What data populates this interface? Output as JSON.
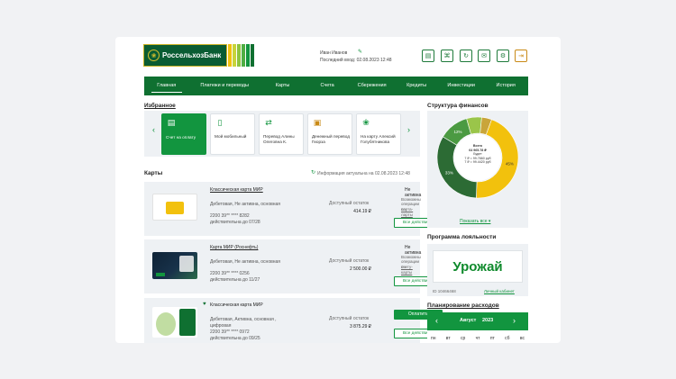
{
  "brand": {
    "name": "РоссельхозБанк",
    "colors": {
      "primary": "#0f7031",
      "accent": "#12953f",
      "gold": "#f2c10d"
    }
  },
  "user": {
    "name": "Иван Иванов",
    "last_login": "Последний вход: 02.08.2023 12:48"
  },
  "toolbar": {
    "icons": [
      "document-icon",
      "receipt-icon",
      "refresh-icon",
      "mail-icon",
      "gear-icon",
      "exit-icon"
    ]
  },
  "nav": {
    "items": [
      "Главная",
      "Платежи и переводы",
      "Карты",
      "Счета",
      "Сбережения",
      "Кредиты",
      "Инвестиции",
      "История"
    ],
    "active": 0
  },
  "favorites": {
    "title": "Избранное",
    "items": [
      {
        "label": "Счет на оплату",
        "icon": "invoice-icon"
      },
      {
        "label": "Мой мобильный",
        "icon": "phone-icon"
      },
      {
        "label": "Перевод Алины Олеговна К.",
        "icon": "transfer-icon"
      },
      {
        "label": "Денежный перевод Гиорза",
        "icon": "money-icon"
      },
      {
        "label": "На карту Алексий Голубятникова",
        "icon": "card-transfer-icon"
      }
    ]
  },
  "cards": {
    "title": "Карты",
    "info": "Информация актуальна на 02.08.2023 12:48",
    "items": [
      {
        "name": "Классическая карта МИР",
        "type": "Дебетовая, Не активна, основная",
        "number": "2200 39** **** 8282",
        "valid": "действительна до 07/28",
        "balance_label": "Доступный остаток",
        "balance": "414.19 ₽",
        "status": "Не активна",
        "note1": "Возможны",
        "note2": "операции по",
        "note3": "сарта-ларты",
        "button": "Все действия ▸"
      },
      {
        "name": "Карта МИР (Роснефть)",
        "type": "Дебетовая, Не активна, основная",
        "number": "2200 39** **** 0256",
        "valid": "действительна до 11/27",
        "balance_label": "Доступный остаток",
        "balance": "2 500.00 ₽",
        "status": "Не активна",
        "note1": "Возможны",
        "note2": "операции по",
        "note3": "счету-карты",
        "button": "Все действия ▸"
      },
      {
        "name": "Классическая карта МИР",
        "type": "Дебетовая, Активна, основная ,",
        "type2": "цифровая",
        "number": "2200 39** **** 0972",
        "valid": "действительна до 09/25",
        "balance_label": "Доступный остаток",
        "balance": "3 875.29 ₽",
        "primary_button": "Оплатить",
        "button": "Все действия ▸"
      }
    ]
  },
  "finance": {
    "title": "Структура финансов",
    "center_label": "Всего",
    "center_value": "64 965.78 ₽",
    "center_sub": "Будет",
    "center_line1": "7 ₽ = 99.7660 руб",
    "center_line2": "7 ₽ = 99.4420 руб",
    "show_all": "Показать все ▾"
  },
  "chart_data": {
    "type": "pie",
    "title": "Структура финансов",
    "categories": [
      "",
      "",
      "",
      "",
      ""
    ],
    "values": [
      45,
      33,
      12,
      6,
      4
    ],
    "data_labels": [
      "45%",
      "33%",
      "12%",
      "",
      ""
    ],
    "colors": [
      "#f2c10d",
      "#2c6b34",
      "#4b9a42",
      "#9ac54a",
      "#c9a53a"
    ]
  },
  "loyalty": {
    "title": "Программа лояльности",
    "logo_text": "Урожай",
    "id_text": "ID 10466468",
    "link": "Личный кабинет"
  },
  "planning": {
    "title": "Планирование расходов",
    "month": "Август",
    "year": "2023",
    "weekdays": [
      "пн",
      "вт",
      "ср",
      "чт",
      "пт",
      "сб",
      "вс"
    ]
  }
}
